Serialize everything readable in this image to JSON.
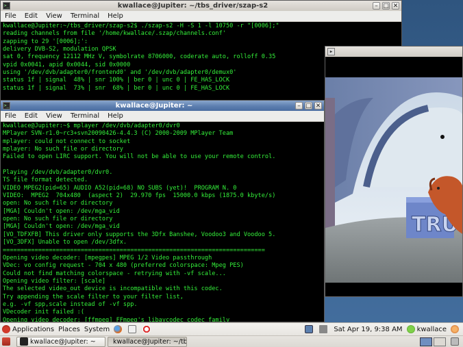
{
  "colors": {
    "terminal_fg": "#34f03a",
    "terminal_bg": "#000000",
    "active_title": "#5c7eaf",
    "panel": "#e6e3de"
  },
  "menu": {
    "file": "File",
    "edit": "Edit",
    "view": "View",
    "terminal": "Terminal",
    "help": "Help"
  },
  "window_top": {
    "title": "kwallace@Jupiter: ~/tbs_driver/szap-s2",
    "lines": [
      "kwallace@Jupiter:~/tbs_driver/szap-s2$ ./szap-s2 -H -S 1 -l 10750 -r \"[0006];\"",
      "reading channels from file '/home/kwallace/.szap/channels.conf'",
      "zapping to 29 '[0006];':",
      "delivery DVB-S2, modulation QPSK",
      "sat 0, frequency 12112 MHz V, symbolrate 8706000, coderate auto, rolloff 0.35",
      "vpid 0x0041, apid 0x0044, sid 0x0000",
      "using '/dev/dvb/adapter0/frontend0' and '/dev/dvb/adapter0/demux0'",
      "status 1f | signal  48% | snr 100% | ber 0 | unc 0 | FE_HAS_LOCK",
      "status 1f | signal  73% | snr  68% | ber 0 | unc 0 | FE_HAS_LOCK"
    ]
  },
  "window_main": {
    "title": "kwallace@Jupiter: ~",
    "lines": [
      "kwallace@Jupiter:~$ mplayer /dev/dvb/adapter0/dvr0",
      "MPlayer SVN-r1.0~rc3+svn20090426-4.4.3 (C) 2000-2009 MPlayer Team",
      "mplayer: could not connect to socket",
      "mplayer: No such file or directory",
      "Failed to open LIRC support. You will not be able to use your remote control.",
      "",
      "Playing /dev/dvb/adapter0/dvr0.",
      "TS file format detected.",
      "VIDEO MPEG2(pid=65) AUDIO A52(pid=68) NO SUBS (yet)!  PROGRAM N. 0",
      "VIDEO:  MPEG2  704x480  (aspect 2)  29.970 fps  15000.0 kbps (1875.0 kbyte/s)",
      "open: No such file or directory",
      "[MGA] Couldn't open: /dev/mga_vid",
      "open: No such file or directory",
      "[MGA] Couldn't open: /dev/mga_vid",
      "[VO_TDFXFB] This driver only supports the 3Dfx Banshee, Voodoo3 and Voodoo 5.",
      "[VO_3DFX] Unable to open /dev/3dfx.",
      "==========================================================================",
      "Opening video decoder: [mpegpes] MPEG 1/2 Video passthrough",
      "VDec: vo config request - 704 x 480 (preferred colorspace: Mpeg PES)",
      "Could not find matching colorspace - retrying with -vf scale...",
      "Opening video filter: [scale]",
      "The selected video_out device is incompatible with this codec.",
      "Try appending the scale filter to your filter list,",
      "e.g. -vf spp,scale instead of -vf spp.",
      "VDecoder init failed :(",
      "Opening video decoder: [ffmpeg] FFmpeg's libavcodec codec family"
    ]
  },
  "video": {
    "logo_text": "TRU"
  },
  "panel": {
    "applications": "Applications",
    "places": "Places",
    "system": "System",
    "clock": "Sat Apr 19,  9:38 AM",
    "user": "kwallace",
    "task1": "kwallace@Jupiter: ~",
    "task2": "kwallace@Jupiter: ~/tb..."
  }
}
